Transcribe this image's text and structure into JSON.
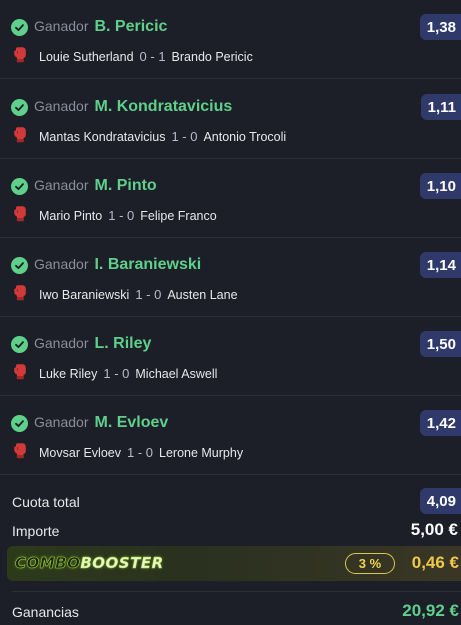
{
  "bets": [
    {
      "market": "Ganador",
      "selection": "B. Pericic",
      "home": "Louie Sutherland",
      "score": "0 - 1",
      "away": "Brando Pericic",
      "odds": "1,38"
    },
    {
      "market": "Ganador",
      "selection": "M. Kondratavicius",
      "home": "Mantas Kondratavicius",
      "score": "1 - 0",
      "away": "Antonio Trocoli",
      "odds": "1,11"
    },
    {
      "market": "Ganador",
      "selection": "M. Pinto",
      "home": "Mario Pinto",
      "score": "1 - 0",
      "away": "Felipe Franco",
      "odds": "1,10"
    },
    {
      "market": "Ganador",
      "selection": "I. Baraniewski",
      "home": "Iwo Baraniewski",
      "score": "1 - 0",
      "away": "Austen Lane",
      "odds": "1,14"
    },
    {
      "market": "Ganador",
      "selection": "L. Riley",
      "home": "Luke Riley",
      "score": "1 - 0",
      "away": "Michael Aswell",
      "odds": "1,50"
    },
    {
      "market": "Ganador",
      "selection": "M. Evloev",
      "home": "Movsar Evloev",
      "score": "1 - 0",
      "away": "Lerone Murphy",
      "odds": "1,42"
    }
  ],
  "summary": {
    "total_odds_label": "Cuota total",
    "total_odds": "4,09",
    "stake_label": "Importe",
    "stake": "5,00 €",
    "booster": {
      "logo_part1": "COMBO",
      "logo_part2": "BOOSTER",
      "percent": "3 %",
      "amount": "0,46 €"
    },
    "winnings_label": "Ganancias",
    "winnings": "20,92 €"
  },
  "colors": {
    "background": "#1c1e28",
    "win_green": "#5fd08a",
    "odds_badge": "#2f3a6b",
    "booster_gold": "#f0c84a"
  },
  "icons": {
    "status": "check-circle-icon",
    "sport": "boxing-glove-icon"
  }
}
